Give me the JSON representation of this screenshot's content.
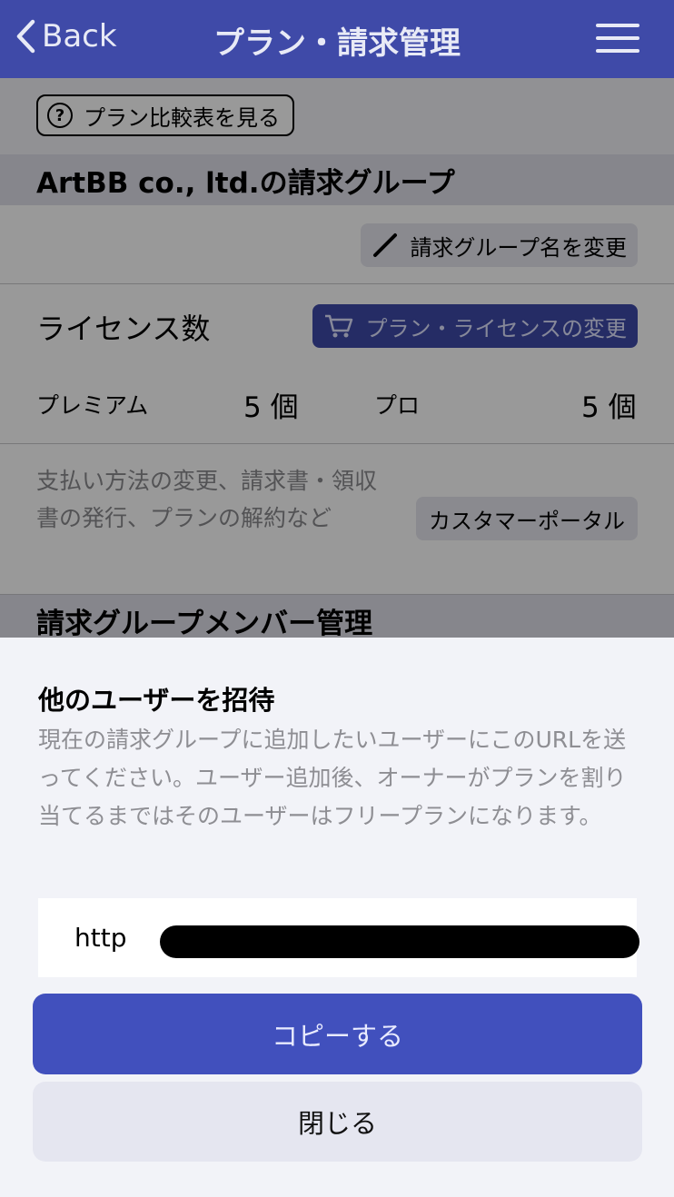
{
  "nav": {
    "back_label": "Back",
    "title": "プラン・請求管理"
  },
  "page": {
    "compare_button": "プラン比較表を見る",
    "group_title": "ArtBB co., ltd.の請求グループ",
    "rename_button": "請求グループ名を変更",
    "license_label": "ライセンス数",
    "license_button": "プラン・ライセンスの変更",
    "plans": [
      {
        "name": "プレミアム",
        "count": "5 個"
      },
      {
        "name": "プロ",
        "count": "5 個"
      }
    ],
    "portal_text": "支払い方法の変更、請求書・領収書の発行、プランの解約など",
    "portal_button": "カスタマーポータル",
    "members_title": "請求グループメンバー管理"
  },
  "sheet": {
    "title": "他のユーザーを招待",
    "description": "現在の請求グループに追加したいユーザーにこのURLを送ってください。ユーザー追加後、オーナーがプランを割り当てるまではそのユーザーはフリープランになります。",
    "url_value": "http",
    "copy_button": "コピーする",
    "close_button": "閉じる"
  },
  "colors": {
    "nav_bg": "#3f4aa8",
    "primary_button": "#4150bd",
    "secondary_button": "#e5e6f0"
  }
}
